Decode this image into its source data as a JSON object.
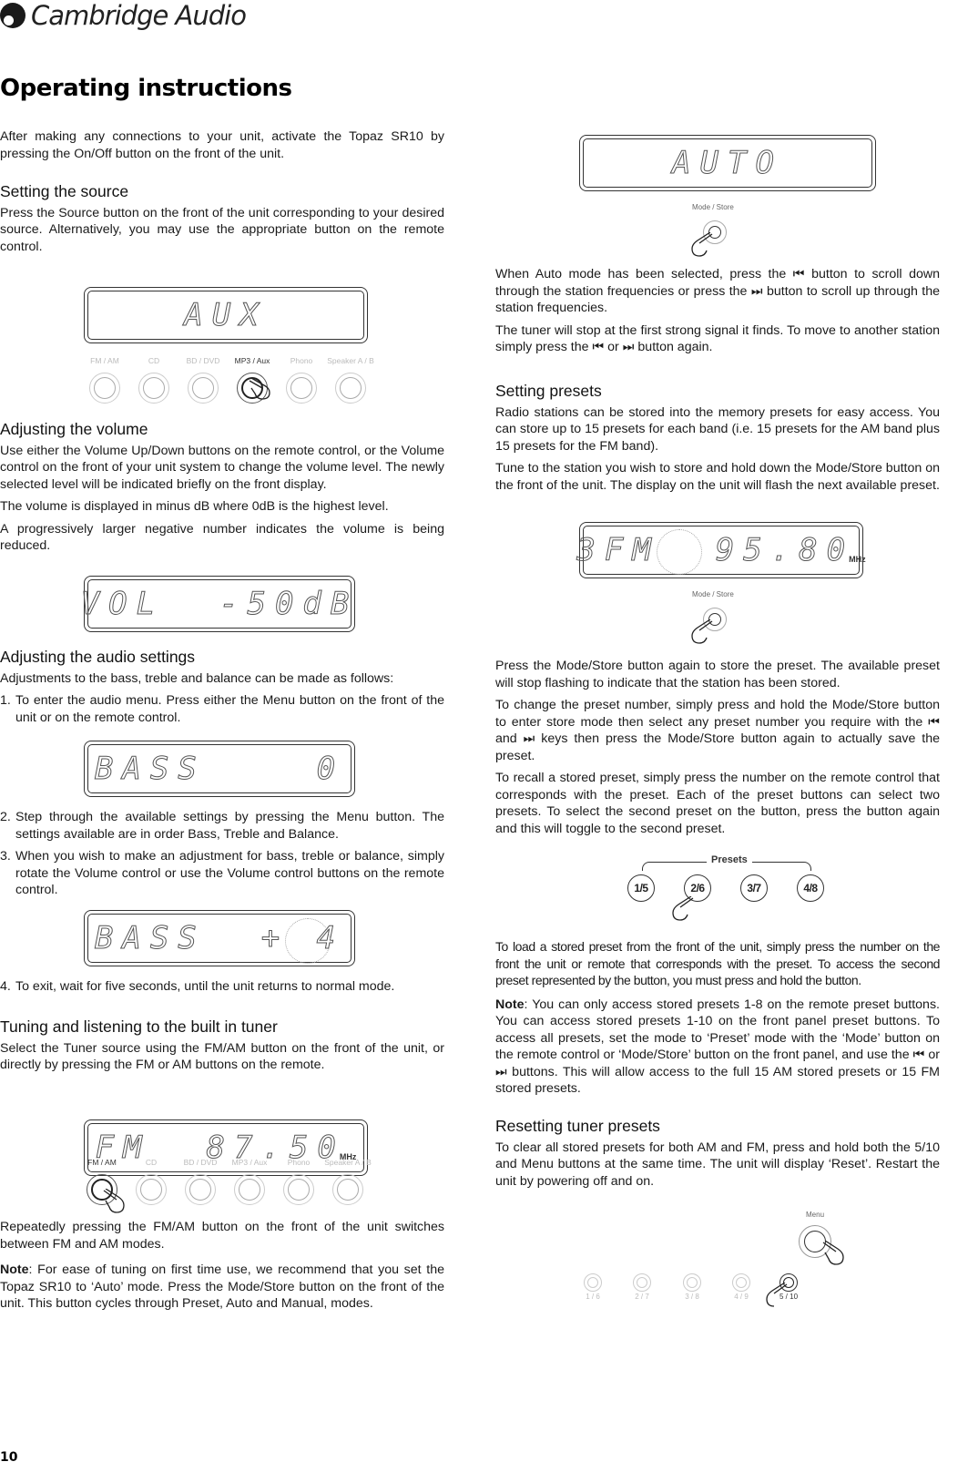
{
  "brand": {
    "name": "Cambridge Audio",
    "logo_icon": "cambridge-audio-logo-icon"
  },
  "page_title": "Operating instructions",
  "page_number": "10",
  "left": {
    "intro": "After making any connections to your unit, activate the Topaz SR10 by pressing the On/Off button on the front of the unit.",
    "source": {
      "heading": "Setting the source",
      "text": "Press the Source button on the front of the unit corresponding to your desired source. Alternatively, you may use the appropriate button on the remote control.",
      "display": "AUX",
      "buttons": [
        {
          "label": "FM / AM",
          "active": false
        },
        {
          "label": "CD",
          "active": false
        },
        {
          "label": "BD / DVD",
          "active": false
        },
        {
          "label": "MP3 / Aux",
          "active": true
        },
        {
          "label": "Phono",
          "active": false
        },
        {
          "label": "Speaker A / B",
          "active": false
        }
      ]
    },
    "volume": {
      "heading": "Adjusting the volume",
      "p1": "Use either the Volume Up/Down buttons on the remote control, or the Volume control on the front of your unit system to change the volume level. The newly selected level will be indicated briefly on the front display.",
      "p2": "The volume is displayed in minus dB where 0dB is the highest level.",
      "p3": "A progressively larger negative number indicates the volume is being reduced.",
      "display": "VOL  -50dB"
    },
    "audio": {
      "heading": "Adjusting the audio settings",
      "intro": "Adjustments to the bass, treble and balance can be made as follows:",
      "steps": [
        {
          "num": "1.",
          "text": "To enter the audio menu. Press either the Menu button on the front of the unit or on the remote control."
        },
        {
          "num": "2.",
          "text": "Step through the available settings by pressing the Menu button. The settings available are in order Bass, Treble and Balance."
        },
        {
          "num": "3.",
          "text": "When you wish to make an adjustment for bass, treble or balance, simply rotate the Volume control or use the Volume control buttons on the remote control."
        },
        {
          "num": "4.",
          "text": "To exit, wait for five seconds, until the unit returns to normal mode."
        }
      ],
      "display1": "BASS    0",
      "display2": "BASS  + 4"
    },
    "tuner": {
      "heading": "Tuning and listening to the built in tuner",
      "text": "Select the Tuner source using the FM/AM button on the front of the unit, or directly by pressing the FM or AM buttons on the remote.",
      "display": "FM  87.50",
      "display_unit": "MHz",
      "buttons": [
        {
          "label": "FM / AM",
          "active": true
        },
        {
          "label": "CD",
          "active": false
        },
        {
          "label": "BD / DVD",
          "active": false
        },
        {
          "label": "MP3 / Aux",
          "active": false
        },
        {
          "label": "Phono",
          "active": false
        },
        {
          "label": "Speaker A / B",
          "active": false
        }
      ],
      "p2": "Repeatedly pressing the FM/AM button on the front of the unit switches between FM and AM modes.",
      "note_label": "Note",
      "note": ": For ease of tuning on first time use, we recommend that you set the Topaz SR10 to ‘Auto’ mode. Press the Mode/Store button on the front of the unit. This button cycles through Preset, Auto and Manual, modes."
    }
  },
  "right": {
    "auto_display": "AUTO",
    "mode_store_label": "Mode / Store",
    "auto_p1": "When Auto mode has been selected, press the ⏮ button to scroll down through the station frequencies or press the ⏭ button to scroll up through the station frequencies.",
    "auto_p2": "The tuner will stop at the first strong signal it finds. To move to another station simply press the ⏮ or ⏭ button again.",
    "presets": {
      "heading": "Setting presets",
      "p1": "Radio stations can be stored into the memory presets for easy access. You can store up to 15 presets for each band (i.e. 15 presets for the AM band plus 15 presets for the FM band).",
      "p2": "Tune to the station you wish to store and hold down the Mode/Store button on the front of the unit. The display on the unit will flash the next available preset.",
      "display_preset": "3",
      "display": "FM  95.80",
      "display_unit": "MHz",
      "p3": "Press the Mode/Store button again to store the preset. The available preset will stop flashing to indicate that the station has been stored.",
      "p4": "To change the preset number, simply press and hold the Mode/Store button to enter store mode then select any preset number you require with the ⏮ and ⏭ keys then press the Mode/Store button again to actually save the preset.",
      "p5": "To recall a stored preset, simply press the number on the remote control that corresponds with the preset. Each of the preset buttons can select two presets. To select the second preset on the button, press the button again and this will toggle to the second preset.",
      "group_label": "Presets",
      "preset_buttons": [
        "1/5",
        "2/6",
        "3/7",
        "4/8"
      ],
      "p6": "To load a stored preset from the front of the unit, simply press the number on the front the unit or remote that corresponds with the preset. To access the second preset represented by the button, you must press and hold the button.",
      "note_label": "Note",
      "note": ": You can only access stored presets 1-8 on the remote preset buttons. You can access stored presets 1-10 on the front panel preset buttons. To access all presets, set the mode to ‘Preset’ mode with the ‘Mode’ button on the remote control or ‘Mode/Store’ button on the front panel, and use the ⏮ or ⏭ buttons. This will allow access to the full 15 AM stored presets or 15 FM stored presets."
    },
    "reset": {
      "heading": "Resetting tuner presets",
      "text": "To clear all stored presets for both AM and FM, press and hold both the 5/10 and Menu buttons at the same time. The unit will display ‘Reset’. Restart the unit by powering off and on.",
      "menu_label": "Menu",
      "number_buttons": [
        {
          "label": "1 / 6",
          "active": false
        },
        {
          "label": "2 / 7",
          "active": false
        },
        {
          "label": "3 / 8",
          "active": false
        },
        {
          "label": "4 / 9",
          "active": false
        },
        {
          "label": "5 / 10",
          "active": true
        }
      ]
    }
  }
}
